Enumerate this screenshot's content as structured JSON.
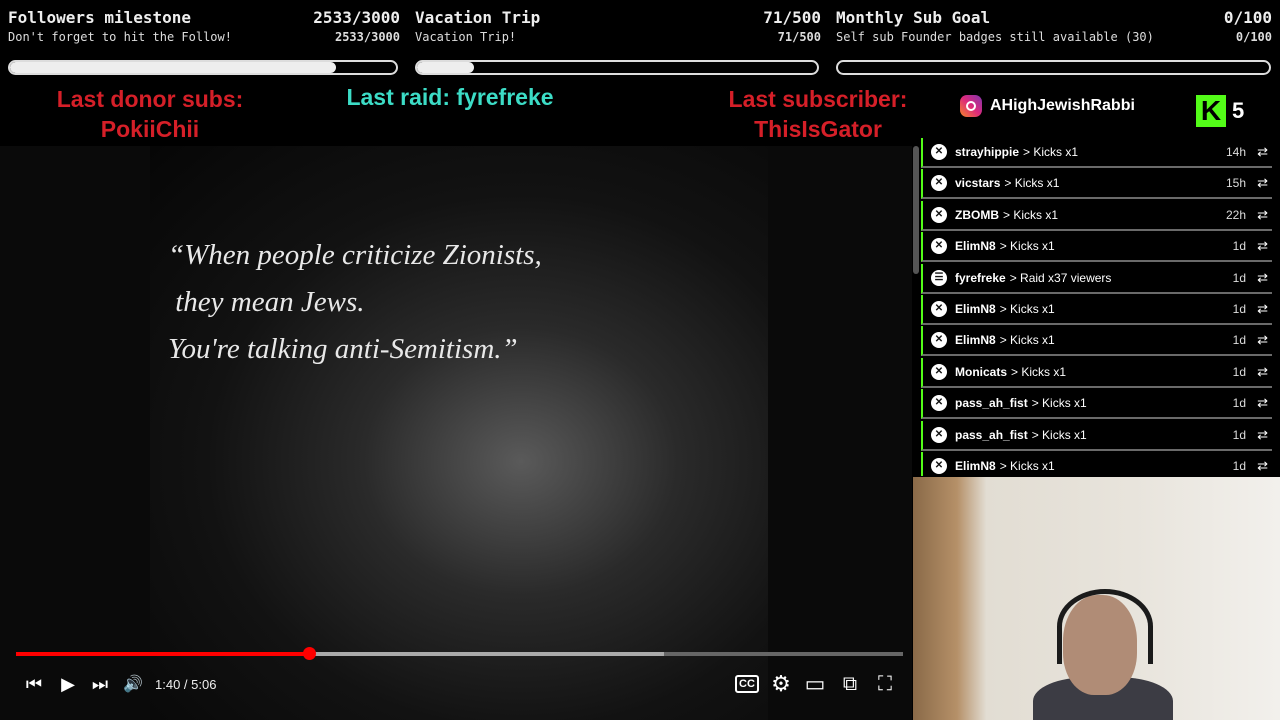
{
  "goals": [
    {
      "title": "Followers milestone",
      "count": "2533/3000",
      "subtitle": "Don't forget to hit the Follow!",
      "sub_count": "2533/3000",
      "progress": 0.844
    },
    {
      "title": "Vacation Trip",
      "count": "71/500",
      "subtitle": "Vacation Trip!",
      "sub_count": "71/500",
      "progress": 0.142
    },
    {
      "title": "Monthly Sub Goal",
      "count": "0/100",
      "subtitle": "Self sub Founder badges still available (30)",
      "sub_count": "0/100",
      "progress": 0
    }
  ],
  "last_donor": {
    "label": "Last donor subs:",
    "name": "PokiiChii"
  },
  "last_raid": {
    "label": "Last raid: fyrefreke"
  },
  "last_subscriber": {
    "label": "Last subscriber:",
    "name": "ThisIsGator"
  },
  "social": {
    "instagram_handle": "AHighJewishRabbi",
    "kick_count": "5",
    "kick_logo": "K"
  },
  "video": {
    "quote_lines": [
      "“When people criticize Zionists,",
      " they mean Jews.",
      "You're talking anti-Semitism.”"
    ],
    "timecode": "1:40 / 5:06",
    "played_fraction": 0.33,
    "buffered_fraction": 0.73,
    "controls": {
      "prev_icon": "⏮",
      "play_icon": "▶",
      "next_icon": "⏭",
      "volume_icon": "🔊",
      "cc_label": "CC",
      "settings_icon": "⚙",
      "miniplayer_icon": "▭",
      "cast_icon": "⧉",
      "fullscreen_icon": "⛶"
    }
  },
  "events": [
    {
      "user": "strayhippie",
      "action": "> Kicks x1",
      "time": "14h",
      "icon": "kick-icon"
    },
    {
      "user": "vicstars",
      "action": "> Kicks x1",
      "time": "15h",
      "icon": "kick-icon"
    },
    {
      "user": "ZBOMB",
      "action": "> Kicks x1",
      "time": "22h",
      "icon": "kick-icon"
    },
    {
      "user": "ElimN8",
      "action": "> Kicks x1",
      "time": "1d",
      "icon": "kick-icon"
    },
    {
      "user": "fyrefreke",
      "action": "> Raid x37 viewers",
      "time": "1d",
      "icon": "raid-icon"
    },
    {
      "user": "ElimN8",
      "action": "> Kicks x1",
      "time": "1d",
      "icon": "kick-icon"
    },
    {
      "user": "ElimN8",
      "action": "> Kicks x1",
      "time": "1d",
      "icon": "kick-icon"
    },
    {
      "user": "Monicats",
      "action": "> Kicks x1",
      "time": "1d",
      "icon": "kick-icon"
    },
    {
      "user": "pass_ah_fist",
      "action": "> Kicks x1",
      "time": "1d",
      "icon": "kick-icon"
    },
    {
      "user": "pass_ah_fist",
      "action": "> Kicks x1",
      "time": "1d",
      "icon": "kick-icon"
    },
    {
      "user": "ElimN8",
      "action": "> Kicks x1",
      "time": "1d",
      "icon": "kick-icon"
    }
  ],
  "colors": {
    "red_label": "#d51f28",
    "raid_teal": "#3cdcc6",
    "kick_green": "#53fc18",
    "progress_red": "#ff0000"
  }
}
